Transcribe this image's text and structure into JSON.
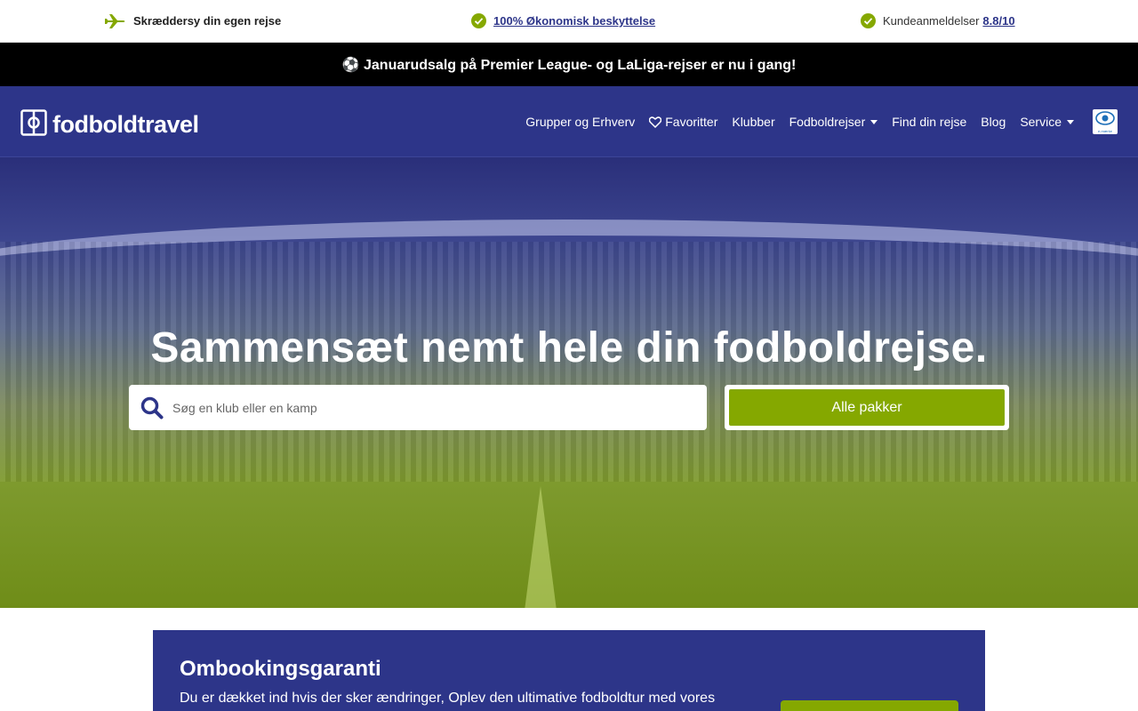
{
  "trust_bar": {
    "item1": "Skræddersy din egen rejse",
    "item2_link": "100% Økonomisk beskyttelse",
    "item3_text": "Kundeanmeldelser",
    "item3_link": "8.8/10"
  },
  "promo": {
    "text": "⚽ Januarudsalg på Premier League- og LaLiga-rejser er nu i gang!"
  },
  "nav": {
    "logo_text": "fodboldtravel",
    "items": [
      "Grupper og Erhverv",
      "Favoritter",
      "Klubber",
      "Fodboldrejser",
      "Find din rejse",
      "Blog",
      "Service"
    ],
    "badge_text": "e-mærke"
  },
  "hero": {
    "title": "Sammensæt nemt hele din fodboldrejse.",
    "search_placeholder": "Søg en klub eller en kamp",
    "all_packages": "Alle pakker"
  },
  "guarantee": {
    "title": "Ombookingsgaranti",
    "text": "Du er dækket ind hvis der sker ændringer, Oplev den ultimative fodboldtur med vores"
  },
  "colors": {
    "brand_blue": "#2d3589",
    "accent_green": "#85a800",
    "promo_black": "#000000"
  }
}
